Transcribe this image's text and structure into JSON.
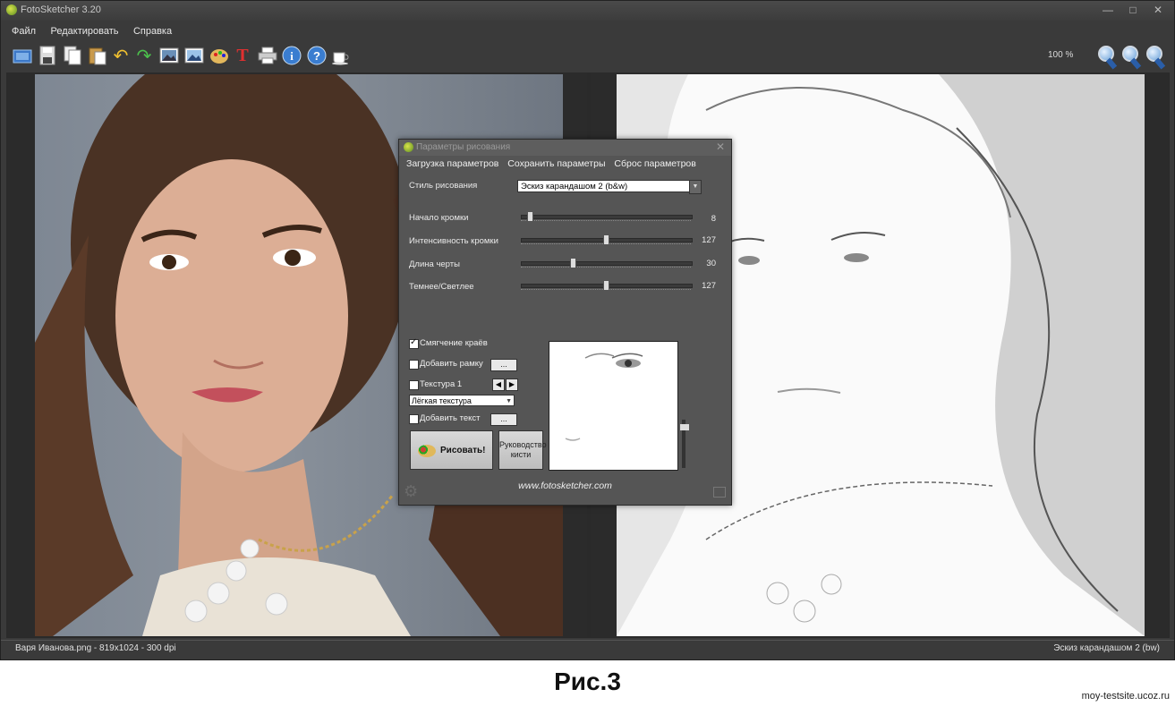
{
  "window": {
    "title": "FotoSketcher 3.20",
    "minimize": "—",
    "maximize": "□",
    "close": "✕"
  },
  "menu": [
    "Файл",
    "Редактировать",
    "Справка"
  ],
  "toolbar": {
    "icons": [
      "open-icon",
      "save-icon",
      "copy-icon",
      "paste-icon",
      "undo-icon",
      "redo-icon",
      "source-image-icon",
      "result-image-icon",
      "palette-icon",
      "text-icon",
      "print-icon",
      "info-icon",
      "help-icon",
      "coffee-icon"
    ],
    "zoom_level": "100 %",
    "zoom_icons": [
      "zoom-in-icon",
      "zoom-out-icon",
      "zoom-fit-icon"
    ]
  },
  "status": {
    "left": "Варя Иванова.png - 819x1024 - 300 dpi",
    "right": "Эскиз карандашом 2 (bw)"
  },
  "dialog": {
    "title": "Параметры рисования",
    "menu": [
      "Загрузка параметров",
      "Сохранить параметры",
      "Сброс параметров"
    ],
    "style_label": "Стиль рисования",
    "style_value": "Эскиз карандашом 2 (b&w)",
    "sliders": [
      {
        "label": "Начало кромки",
        "value": "8",
        "fraction": 0.04
      },
      {
        "label": "Интенсивность кромки",
        "value": "127",
        "fraction": 0.5
      },
      {
        "label": "Длина черты",
        "value": "30",
        "fraction": 0.3
      },
      {
        "label": "Темнее/Светлее",
        "value": "127",
        "fraction": 0.5
      }
    ],
    "smooth_edges": {
      "label": "Смягчение краёв",
      "checked": true
    },
    "add_frame": {
      "label": "Добавить рамку",
      "checked": false,
      "button": "..."
    },
    "texture": {
      "label": "Текстура 1",
      "checked": false,
      "prev": "◀",
      "next": "▶",
      "select": "Лёгкая текстура"
    },
    "add_text": {
      "label": "Добавить текст",
      "checked": false,
      "button": "..."
    },
    "draw_button": "Рисовать!",
    "guide_button": "Руководство кисти",
    "website": "www.fotosketcher.com"
  },
  "caption": "Рис.3",
  "watermark": "moy-testsite.ucoz.ru",
  "colors": {
    "app_bg": "#3a3a3a",
    "dialog_bg": "#555555",
    "accent": "#4a90d9"
  }
}
